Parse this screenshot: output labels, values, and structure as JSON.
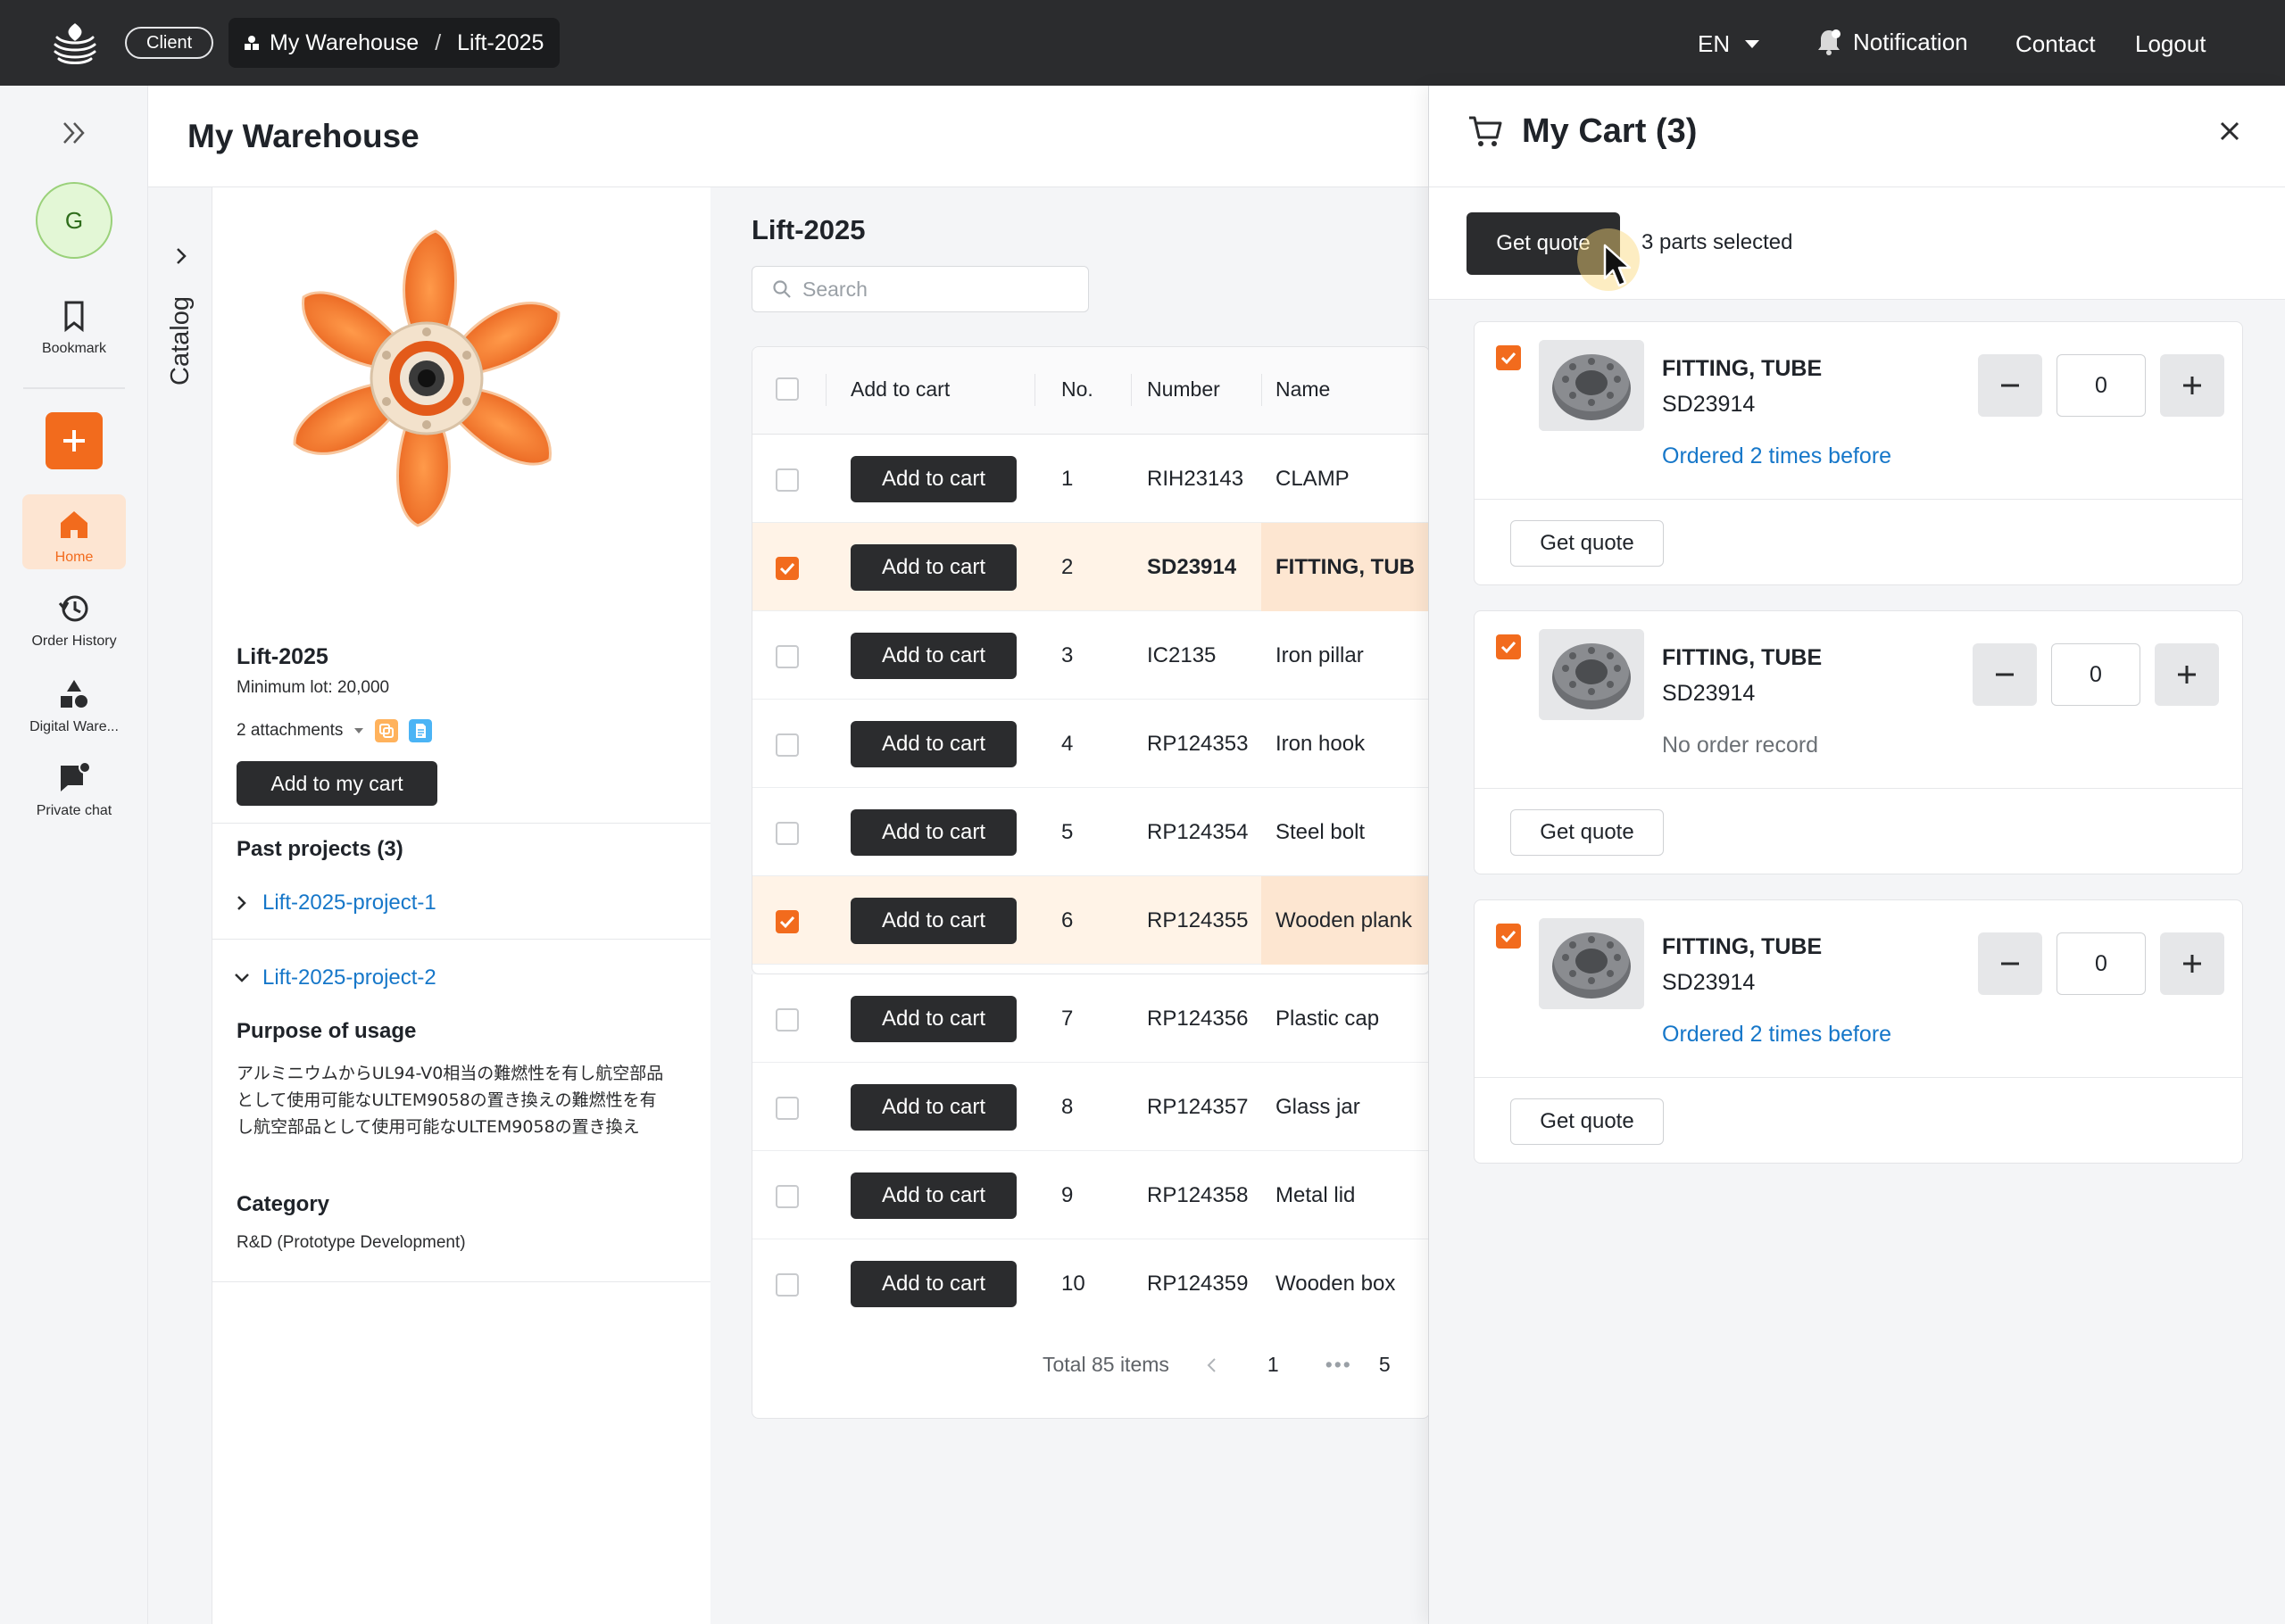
{
  "topbar": {
    "client_label": "Client",
    "breadcrumb": [
      "My Warehouse",
      "Lift-2025"
    ],
    "breadcrumb_sep": "/",
    "language": "EN",
    "notification": "Notification",
    "contact": "Contact",
    "logout": "Logout"
  },
  "rail": {
    "avatar_initial": "G",
    "items": [
      {
        "label": "Bookmark",
        "icon": "bookmark-icon"
      },
      {
        "label": "Home",
        "icon": "home-icon",
        "active": true
      },
      {
        "label": "Order History",
        "icon": "history-icon"
      },
      {
        "label": "Digital Ware...",
        "icon": "shapes-icon"
      },
      {
        "label": "Private chat",
        "icon": "chat-icon"
      }
    ],
    "accent": "#f26b1d"
  },
  "page": {
    "title": "My Warehouse"
  },
  "catalog": {
    "label": "Catalog"
  },
  "details": {
    "title": "Lift-2025",
    "min_lot": "Minimum lot: 20,000",
    "attachments": "2 attachments",
    "add_button": "Add to my cart",
    "past_projects": "Past projects (3)",
    "projects": [
      {
        "name": "Lift-2025-project-1",
        "expanded": false
      },
      {
        "name": "Lift-2025-project-2",
        "expanded": true
      }
    ],
    "purpose_heading": "Purpose of usage",
    "purpose_text": "アルミニウムからUL94-V0相当の難燃性を有し航空部品として使用可能なULTEM9058の置き換えの難燃性を有し航空部品として使用可能なULTEM9058の置き換え",
    "category_heading": "Category",
    "category_value": "R&D (Prototype Development)"
  },
  "table": {
    "title": "Lift-2025",
    "search_placeholder": "Search",
    "headers": [
      "Add to cart",
      "No.",
      "Number",
      "Name"
    ],
    "add_label": "Add to cart",
    "rows": [
      {
        "no": "1",
        "number": "RIH23143",
        "name": "CLAMP",
        "selected": false
      },
      {
        "no": "2",
        "number": "SD23914",
        "name": "FITTING, TUB",
        "selected": true
      },
      {
        "no": "3",
        "number": "IC2135",
        "name": "Iron pillar",
        "selected": false
      },
      {
        "no": "4",
        "number": "RP124353",
        "name": "Iron hook",
        "selected": false
      },
      {
        "no": "5",
        "number": "RP124354",
        "name": "Steel bolt",
        "selected": false
      },
      {
        "no": "6",
        "number": "RP124355",
        "name": "Wooden plank",
        "selected": true
      },
      {
        "no": "7",
        "number": "RP124356",
        "name": "Plastic cap",
        "selected": false
      },
      {
        "no": "8",
        "number": "RP124357",
        "name": "Glass jar",
        "selected": false
      },
      {
        "no": "9",
        "number": "RP124358",
        "name": "Metal lid",
        "selected": false
      },
      {
        "no": "10",
        "number": "RP124359",
        "name": "Wooden box",
        "selected": false
      }
    ],
    "total": "Total 85 items",
    "page_current": "1",
    "page_ellipsis": "•••",
    "page_last": "5"
  },
  "cart": {
    "title": "My Cart (3)",
    "get_quote": "Get quote",
    "selected_text": "3 parts selected",
    "items": [
      {
        "name": "FITTING, TUBE",
        "number": "SD23914",
        "history": "Ordered 2 times before",
        "history_type": "link",
        "qty": "0"
      },
      {
        "name": "FITTING, TUBE",
        "number": "SD23914",
        "history": "No order record",
        "history_type": "muted",
        "qty": "0"
      },
      {
        "name": "FITTING, TUBE",
        "number": "SD23914",
        "history": "Ordered 2 times before",
        "history_type": "link",
        "qty": "0"
      }
    ],
    "item_quote_label": "Get quote"
  }
}
